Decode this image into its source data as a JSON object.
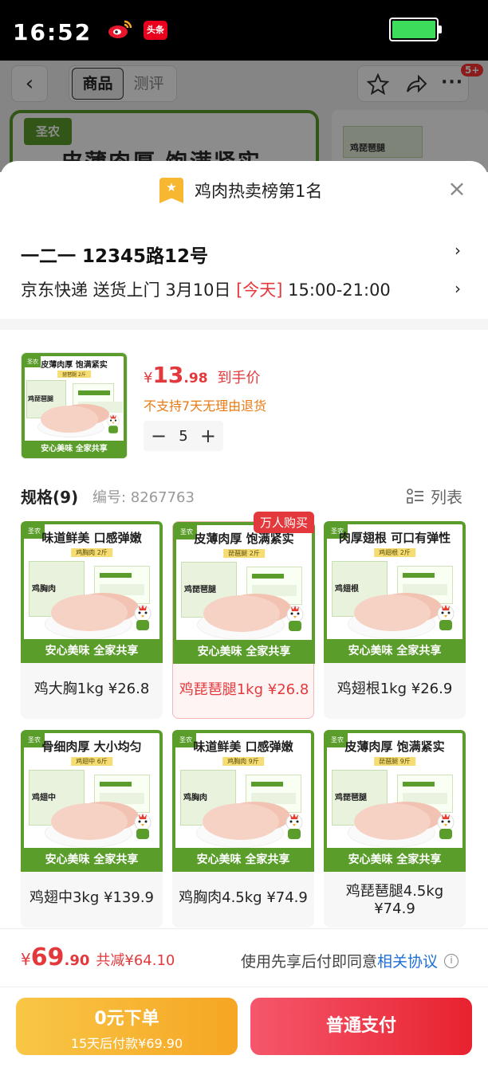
{
  "status_bar": {
    "time": "16:52",
    "apps": [
      "weibo-icon",
      "toutiao-icon"
    ],
    "toutiao_label": "头条",
    "battery_color": "#3ddc5b"
  },
  "background_page": {
    "back_icon": "‹",
    "tabs": [
      "商品",
      "测评"
    ],
    "badge": "5+",
    "banner_text": "皮薄肉厚 饱满紧实",
    "banner_logo": "圣农",
    "thumb_text": "鸡琵琶腿"
  },
  "sheet": {
    "rank_text": "鸡肉热卖榜第1名",
    "address": "一二一  12345路12号",
    "delivery": {
      "prefix": "京东快递 送货上门 3月10日 ",
      "today": "[今天]",
      "time": " 15:00-21:00"
    }
  },
  "product": {
    "thumb": {
      "headline": "皮薄肉厚 饱满紧实",
      "subline": "琵琶腿 2斤",
      "pack": "鸡琵琶腿",
      "footer": "安心美味 全家共享"
    },
    "price_currency": "¥",
    "price_int": "13",
    "price_dec": ".98",
    "price_label": "到手价",
    "no_return": "不支持7天无理由退货",
    "qty": "5",
    "minus": "−",
    "plus": "+"
  },
  "specs": {
    "title": "规格(9)",
    "code": "编号: 8267763",
    "list_label": "列表",
    "items": [
      {
        "headline": "味道鲜美 口感弹嫩",
        "subline": "鸡胸肉 2斤",
        "pack": "鸡胸肉",
        "footer": "安心美味 全家共享",
        "label": "鸡大胸1kg ¥26.8",
        "selected": false
      },
      {
        "headline": "皮薄肉厚 饱满紧实",
        "subline": "琵琶腿 2斤",
        "pack": "鸡琵琶腿",
        "footer": "安心美味 全家共享",
        "label": "鸡琵琶腿1kg ¥26.8",
        "selected": true,
        "tag": "万人购买"
      },
      {
        "headline": "肉厚翅根 可口有弹性",
        "subline": "鸡翅根 2斤",
        "pack": "鸡翅根",
        "footer": "安心美味 全家共享",
        "label": "鸡翅根1kg ¥26.9",
        "selected": false
      },
      {
        "headline": "骨细肉厚 大小均匀",
        "subline": "鸡翅中 6斤",
        "pack": "鸡翅中",
        "footer": "安心美味 全家共享",
        "label": "鸡翅中3kg ¥139.9",
        "selected": false
      },
      {
        "headline": "味道鲜美 口感弹嫩",
        "subline": "鸡胸肉 9斤",
        "pack": "鸡胸肉",
        "footer": "安心美味 全家共享",
        "label": "鸡胸肉4.5kg ¥74.9",
        "selected": false
      },
      {
        "headline": "皮薄肉厚 饱满紧实",
        "subline": "琵琶腿 9斤",
        "pack": "鸡琵琶腿",
        "footer": "安心美味 全家共享",
        "label": "鸡琵琶腿4.5kg ¥74.9",
        "selected": false
      }
    ]
  },
  "checkout": {
    "total_currency": "¥",
    "total_int": "69",
    "total_dec": ".90",
    "saved": "共减¥64.10",
    "agree_prefix": "使用先享后付即同意",
    "agree_link": "相关协议",
    "info_icon": "i",
    "later_main": "0元下单",
    "later_sub": "15天后付款¥69.90",
    "pay_label": "普通支付",
    "colors": {
      "accent": "#e4393c",
      "brand_green": "#5a9d2a",
      "later_button": "#f5a623"
    }
  }
}
